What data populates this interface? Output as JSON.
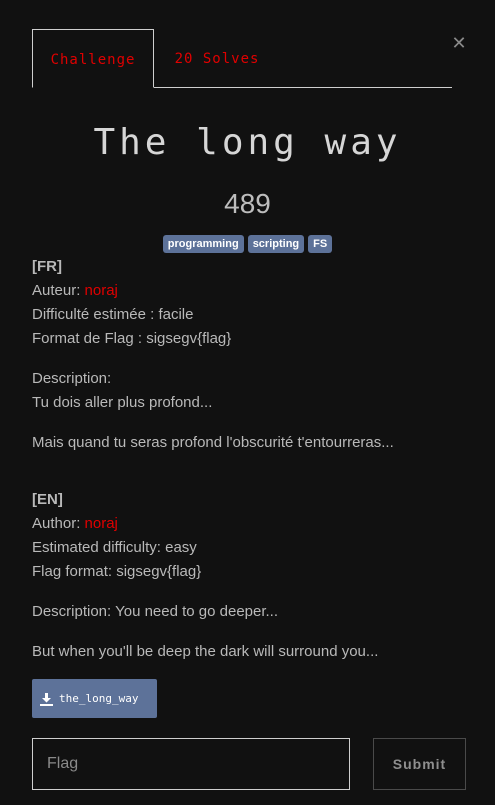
{
  "modal": {
    "close_icon": "close-icon",
    "tabs": [
      {
        "label": "Challenge",
        "active": true
      },
      {
        "label": "20 Solves",
        "active": false
      }
    ],
    "title": "The long way",
    "value": "489",
    "tags": [
      "programming",
      "scripting",
      "FS"
    ],
    "fr": {
      "header": "[FR]",
      "author_label": "Auteur: ",
      "author": "noraj",
      "difficulty": "Difficulté estimée : facile",
      "flag_format": "Format de Flag : sigsegv{flag}",
      "description_label": "Description:",
      "description": "Tu dois aller plus profond...",
      "extra": "Mais quand tu seras profond l'obscurité t'entourreras..."
    },
    "en": {
      "header": "[EN]",
      "author_label": "Author: ",
      "author": "noraj",
      "difficulty": "Estimated difficulty: easy",
      "flag_format": "Flag format: sigsegv{flag}",
      "description": "Description: You need to go deeper...",
      "extra": "But when you'll be deep the dark will surround you..."
    },
    "file": {
      "label": "the_long_way",
      "icon": "download-icon"
    },
    "flag_placeholder": "Flag",
    "submit_label": "Submit",
    "colors": {
      "accent": "#e00000",
      "tag": "#5d7299",
      "background": "#111111"
    }
  }
}
